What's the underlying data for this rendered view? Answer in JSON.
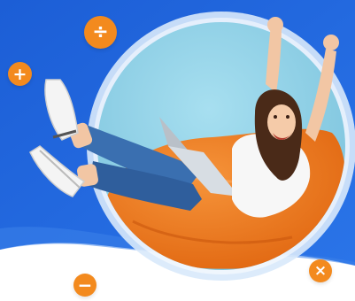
{
  "hero": {
    "badges": {
      "divide": "÷",
      "plus": "+",
      "minus": "−",
      "times": "×"
    },
    "colors": {
      "brand_blue": "#1e64d8",
      "light_blue": "#2f79e6",
      "accent_orange": "#f38a1e",
      "sky": "#8fd2e8",
      "beanbag": "#f07a1c"
    },
    "icons": [
      "divide-icon",
      "plus-icon",
      "minus-icon",
      "times-icon"
    ]
  }
}
